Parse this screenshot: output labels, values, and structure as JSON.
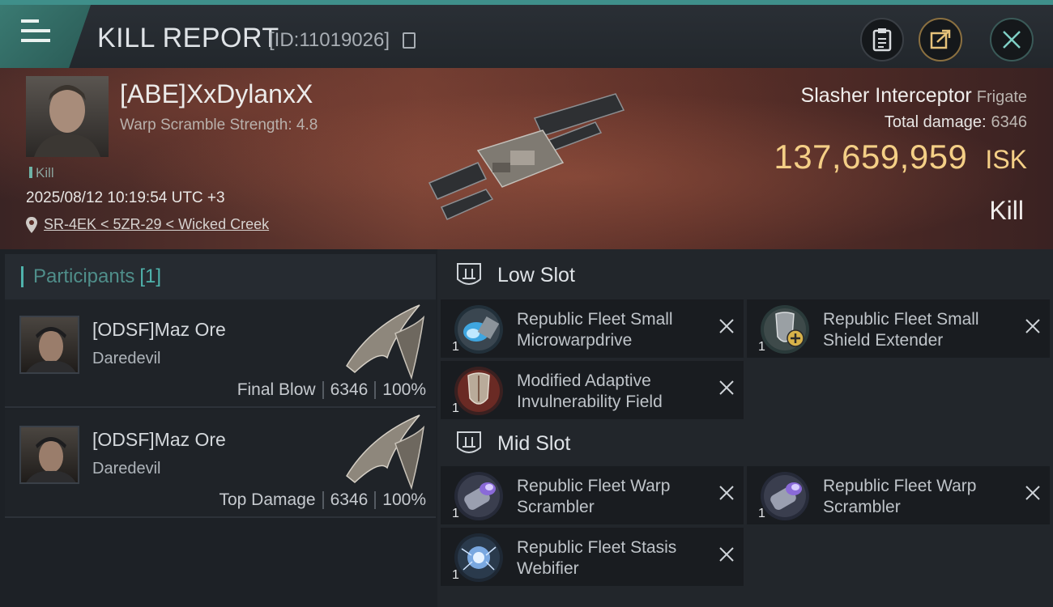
{
  "header": {
    "title": "KILL REPORT",
    "kill_id": "[ID:11019026]"
  },
  "victim": {
    "pilot_name": "[ABE]XxDylanxX",
    "warp_scramble": "Warp Scramble Strength: 4.8",
    "tag": "Kill",
    "timestamp": "2025/08/12 10:19:54 UTC +3",
    "location": "SR-4EK < 5ZR-29 < Wicked Creek",
    "ship_name": "Slasher Interceptor",
    "ship_class": "Frigate",
    "total_damage_label": "Total damage:",
    "total_damage_value": "6346",
    "isk_value": "137,659,959",
    "isk_unit": "ISK",
    "result": "Kill"
  },
  "participants": {
    "label": "Participants",
    "count": "[1]",
    "items": [
      {
        "name": "[ODSF]Maz Ore",
        "ship": "Daredevil",
        "role": "Final Blow",
        "damage": "6346",
        "percent": "100%"
      },
      {
        "name": "[ODSF]Maz Ore",
        "ship": "Daredevil",
        "role": "Top Damage",
        "damage": "6346",
        "percent": "100%"
      }
    ]
  },
  "fitting": {
    "low_slot": {
      "label": "Low Slot",
      "modules": [
        {
          "name": "Republic Fleet Small Microwarpdrive",
          "qty": "1"
        },
        {
          "name": "Republic Fleet Small Shield Extender",
          "qty": "1"
        },
        {
          "name": "Modified Adaptive Invulnerability Field",
          "qty": "1"
        }
      ]
    },
    "mid_slot": {
      "label": "Mid Slot",
      "modules": [
        {
          "name": "Republic Fleet Warp Scrambler",
          "qty": "1"
        },
        {
          "name": "Republic Fleet Warp Scrambler",
          "qty": "1"
        },
        {
          "name": "Republic Fleet Stasis Webifier",
          "qty": "1"
        }
      ]
    }
  },
  "colors": {
    "accent_teal": "#4fb3ac",
    "isk_gold": "#f4cf86"
  },
  "icons": [
    "menu-icon",
    "copy-icon",
    "notes-icon",
    "share-icon",
    "close-icon",
    "location-pin-icon",
    "slot-badge-icon",
    "remove-x-icon"
  ]
}
